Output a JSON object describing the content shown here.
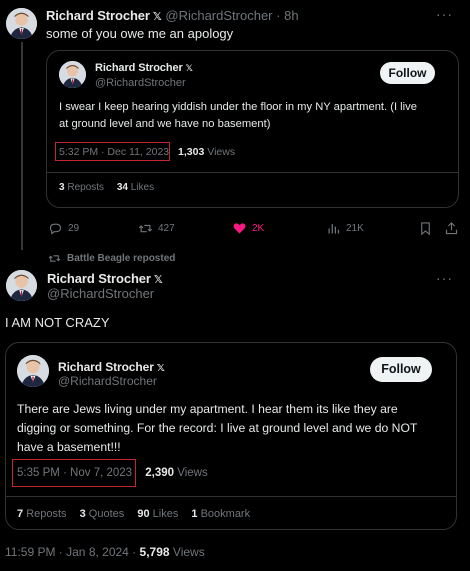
{
  "tweet1": {
    "name": "Richard Strocher",
    "handle": "@RichardStrocher",
    "time": "8h",
    "sep": "·",
    "text": "some of you owe me an apology",
    "quote": {
      "name": "Richard Strocher",
      "handle": "@RichardStrocher",
      "follow": "Follow",
      "text_line1": "I swear I keep hearing yiddish under the floor in my NY apartment. (I live",
      "text_line2": "at ground level and we have no basement)",
      "timestamp": "5:32 PM · Dec 11, 2023",
      "views_count": "1,303",
      "views_label": "Views",
      "reposts_count": "3",
      "reposts_label": "Reposts",
      "likes_count": "34",
      "likes_label": "Likes"
    },
    "actions": {
      "replies": "29",
      "reposts": "427",
      "likes": "2K",
      "views": "21K"
    }
  },
  "repost_banner": "Battle Beagle reposted",
  "tweet2": {
    "name": "Richard Strocher",
    "handle": "@RichardStrocher",
    "text": "I AM NOT CRAZY",
    "quote": {
      "name": "Richard Strocher",
      "handle": "@RichardStrocher",
      "follow": "Follow",
      "text_line1": "There are Jews living under my apartment. I hear them its like they are",
      "text_line2": "digging or something. For the record: I live at ground level and we do NOT",
      "text_line3": "have a basement!!!",
      "timestamp": "5:35 PM · Nov 7, 2023",
      "views_count": "2,390",
      "views_label": "Views",
      "reposts_count": "7",
      "reposts_label": "Reposts",
      "quotes_count": "3",
      "quotes_label": "Quotes",
      "likes_count": "90",
      "likes_label": "Likes",
      "bookmarks_count": "1",
      "bookmarks_label": "Bookmark"
    },
    "timestamp": "11:59 PM · Jan 8, 2024 ·",
    "views_count": "5,798",
    "views_label": "Views"
  },
  "icons": {
    "x_logo": "𝕏",
    "more": "···"
  },
  "colors": {
    "like_active": "#f91880",
    "highlight_box": "#c1272d",
    "follow_bg": "#eff3f4"
  }
}
